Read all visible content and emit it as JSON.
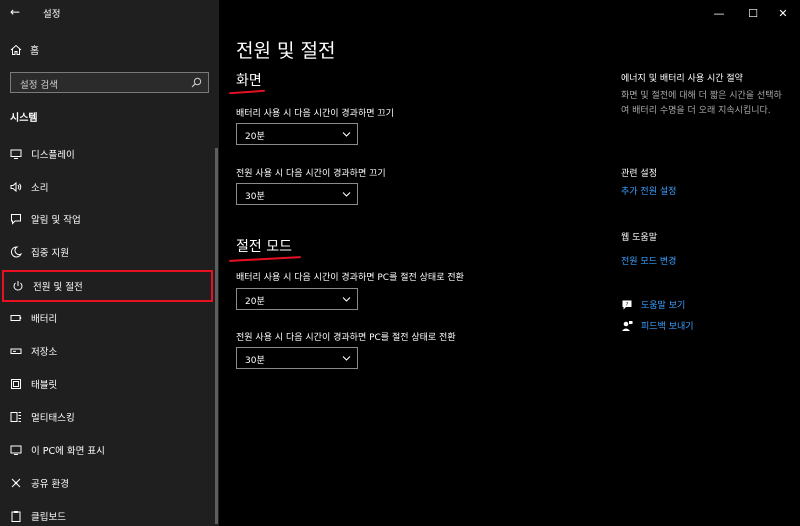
{
  "window": {
    "app_title": "설정",
    "back_glyph": "←",
    "minimize": "—",
    "maximize": "☐",
    "close": "✕"
  },
  "sidebar": {
    "home_label": "홈",
    "search_placeholder": "설정 검색",
    "section_label": "시스템",
    "items": [
      {
        "label": "디스플레이",
        "icon": "display-icon"
      },
      {
        "label": "소리",
        "icon": "sound-icon"
      },
      {
        "label": "알림 및 작업",
        "icon": "notification-icon"
      },
      {
        "label": "집중 지원",
        "icon": "moon-icon"
      },
      {
        "label": "전원 및 절전",
        "icon": "power-icon",
        "selected": true
      },
      {
        "label": "배터리",
        "icon": "battery-icon"
      },
      {
        "label": "저장소",
        "icon": "storage-icon"
      },
      {
        "label": "태블릿",
        "icon": "tablet-icon"
      },
      {
        "label": "멀티태스킹",
        "icon": "multitasking-icon"
      },
      {
        "label": "이 PC에 화면 표시",
        "icon": "project-icon"
      },
      {
        "label": "공유 환경",
        "icon": "shared-icon"
      },
      {
        "label": "클립보드",
        "icon": "clipboard-icon"
      }
    ]
  },
  "main": {
    "title": "전원 및 절전",
    "screen": {
      "heading": "화면",
      "battery_label": "배터리 사용 시 다음 시간이 경과하면 끄기",
      "battery_value": "20분",
      "plugged_label": "전원 사용 시 다음 시간이 경과하면 끄기",
      "plugged_value": "30분"
    },
    "sleep": {
      "heading": "절전 모드",
      "battery_label": "배터리 사용 시 다음 시간이 경과하면 PC를 절전 상태로 전환",
      "battery_value": "20분",
      "plugged_label": "전원 사용 시 다음 시간이 경과하면 PC를 절전 상태로 전환",
      "plugged_value": "30분"
    }
  },
  "right": {
    "energy_title": "에너지 및 배터리 사용 시간 절약",
    "energy_desc": "화면 및 절전에 대해 더 짧은 시간을 선택하여 배터리 수명을 더 오래 지속시킵니다.",
    "related_title": "관련 설정",
    "related_link": "추가 전원 설정",
    "web_help_title": "웹 도움말",
    "web_help_link": "전원 모드 변경",
    "help_link": "도움말 보기",
    "feedback_link": "피드백 보내기"
  },
  "colors": {
    "accent_link": "#3aa0ff",
    "highlight_red": "#e81123",
    "sidebar_bg": "#1f1f1f",
    "main_bg": "#000000"
  }
}
